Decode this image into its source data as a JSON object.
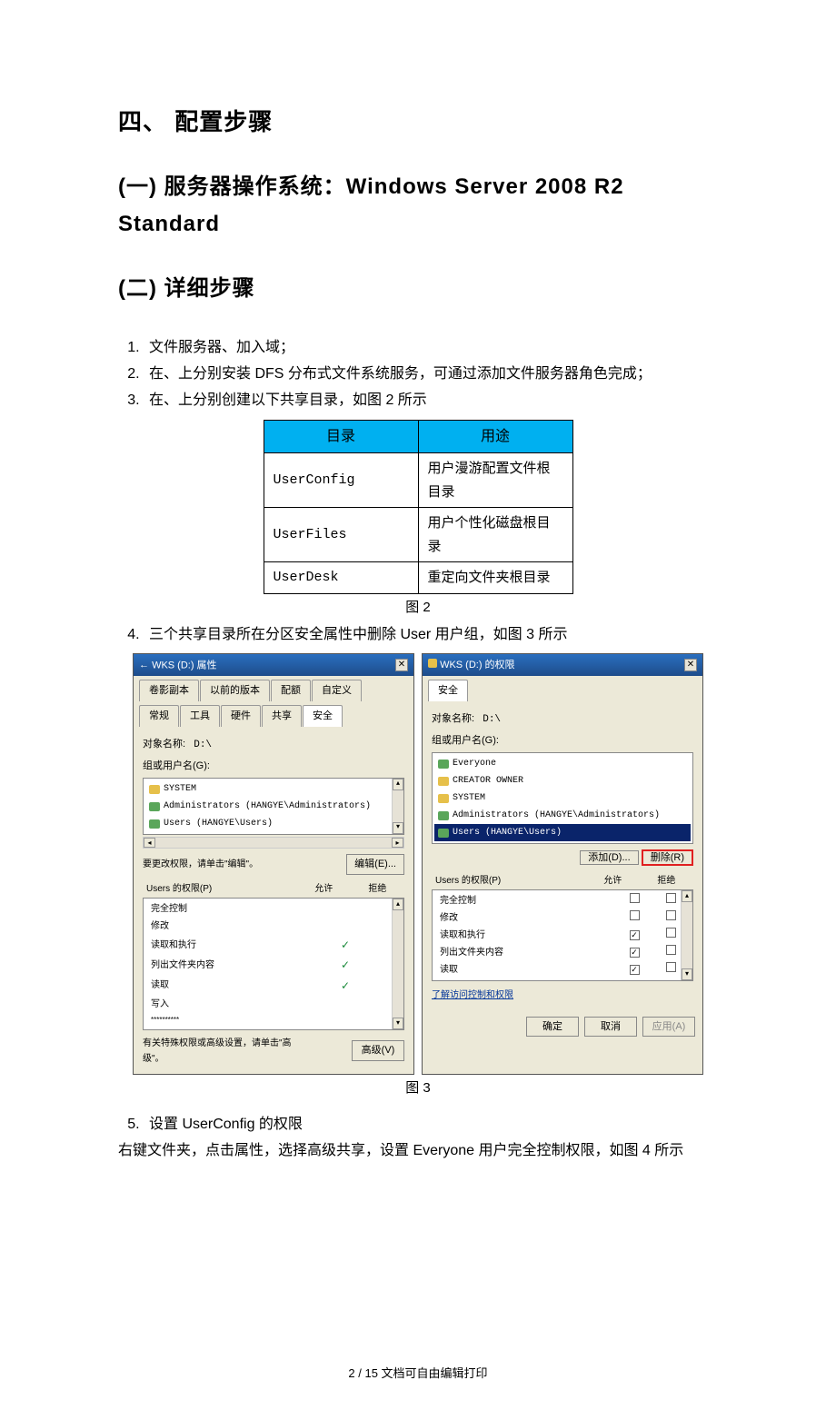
{
  "headings": {
    "h4": "四、 配置步骤",
    "h_sub1": "(一) 服务器操作系统：Windows Server 2008 R2 Standard",
    "h_sub2": "(二)  详细步骤"
  },
  "steps": {
    "s1": "文件服务器、加入域；",
    "s2": "在、上分别安装 DFS 分布式文件系统服务，可通过添加文件服务器角色完成；",
    "s3": "在、上分别创建以下共享目录，如图 2 所示",
    "s4": "三个共享目录所在分区安全属性中删除 User 用户组，如图 3  所示",
    "s5": "设置 UserConfig 的权限",
    "s5t": "右键文件夹，点击属性，选择高级共享，设置 Everyone 用户完全控制权限，如图 4 所示"
  },
  "table": {
    "h1": "目录",
    "h2": "用途",
    "r": [
      {
        "d": "UserConfig",
        "u": "用户漫游配置文件根目录"
      },
      {
        "d": "UserFiles",
        "u": "用户个性化磁盘根目录"
      },
      {
        "d": "UserDesk",
        "u": "重定向文件夹根目录"
      }
    ]
  },
  "figcap2": "图 2",
  "figcap3": "图 3",
  "dlg1": {
    "title": "WKS (D:) 属性",
    "tabs_row1": [
      "卷影副本",
      "以前的版本",
      "配额",
      "自定义"
    ],
    "tabs_row2": [
      "常规",
      "工具",
      "硬件",
      "共享",
      "安全"
    ],
    "objname_lbl": "对象名称:",
    "objname_val": "D:\\",
    "group_lbl": "组或用户名(G):",
    "groups": [
      "SYSTEM",
      "Administrators (HANGYE\\Administrators)",
      "Users (HANGYE\\Users)"
    ],
    "edit_hint": "要更改权限，请单击\"编辑\"。",
    "btn_edit": "编辑(E)...",
    "perm_lbl": "Users 的权限(P)",
    "col_allow": "允许",
    "col_deny": "拒绝",
    "perms": [
      {
        "n": "完全控制",
        "a": "",
        "d": ""
      },
      {
        "n": "修改",
        "a": "",
        "d": ""
      },
      {
        "n": "读取和执行",
        "a": "✓",
        "d": ""
      },
      {
        "n": "列出文件夹内容",
        "a": "✓",
        "d": ""
      },
      {
        "n": "读取",
        "a": "✓",
        "d": ""
      },
      {
        "n": "写入",
        "a": "",
        "d": ""
      },
      {
        "n": "**********",
        "a": "",
        "d": ""
      }
    ],
    "adv_hint": "有关特殊权限或高级设置，请单击\"高级\"。",
    "btn_adv": "高级(V)"
  },
  "dlg2": {
    "title": "WKS (D:) 的权限",
    "sec_tab": "安全",
    "objname_lbl": "对象名称:",
    "objname_val": "D:\\",
    "group_lbl": "组或用户名(G):",
    "groups": [
      "Everyone",
      "CREATOR OWNER",
      "SYSTEM",
      "Administrators (HANGYE\\Administrators)",
      "Users (HANGYE\\Users)"
    ],
    "btn_add": "添加(D)...",
    "btn_del": "删除(R)",
    "perm_lbl": "Users 的权限(P)",
    "col_allow": "允许",
    "col_deny": "拒绝",
    "perms": [
      {
        "n": "完全控制",
        "a": false,
        "d": false
      },
      {
        "n": "修改",
        "a": false,
        "d": false
      },
      {
        "n": "读取和执行",
        "a": true,
        "d": false
      },
      {
        "n": "列出文件夹内容",
        "a": true,
        "d": false
      },
      {
        "n": "读取",
        "a": true,
        "d": false
      }
    ],
    "link": "了解访问控制和权限",
    "btn_ok": "确定",
    "btn_cancel": "取消",
    "btn_apply": "应用(A)"
  },
  "footer": "2 / 15 文档可自由编辑打印"
}
